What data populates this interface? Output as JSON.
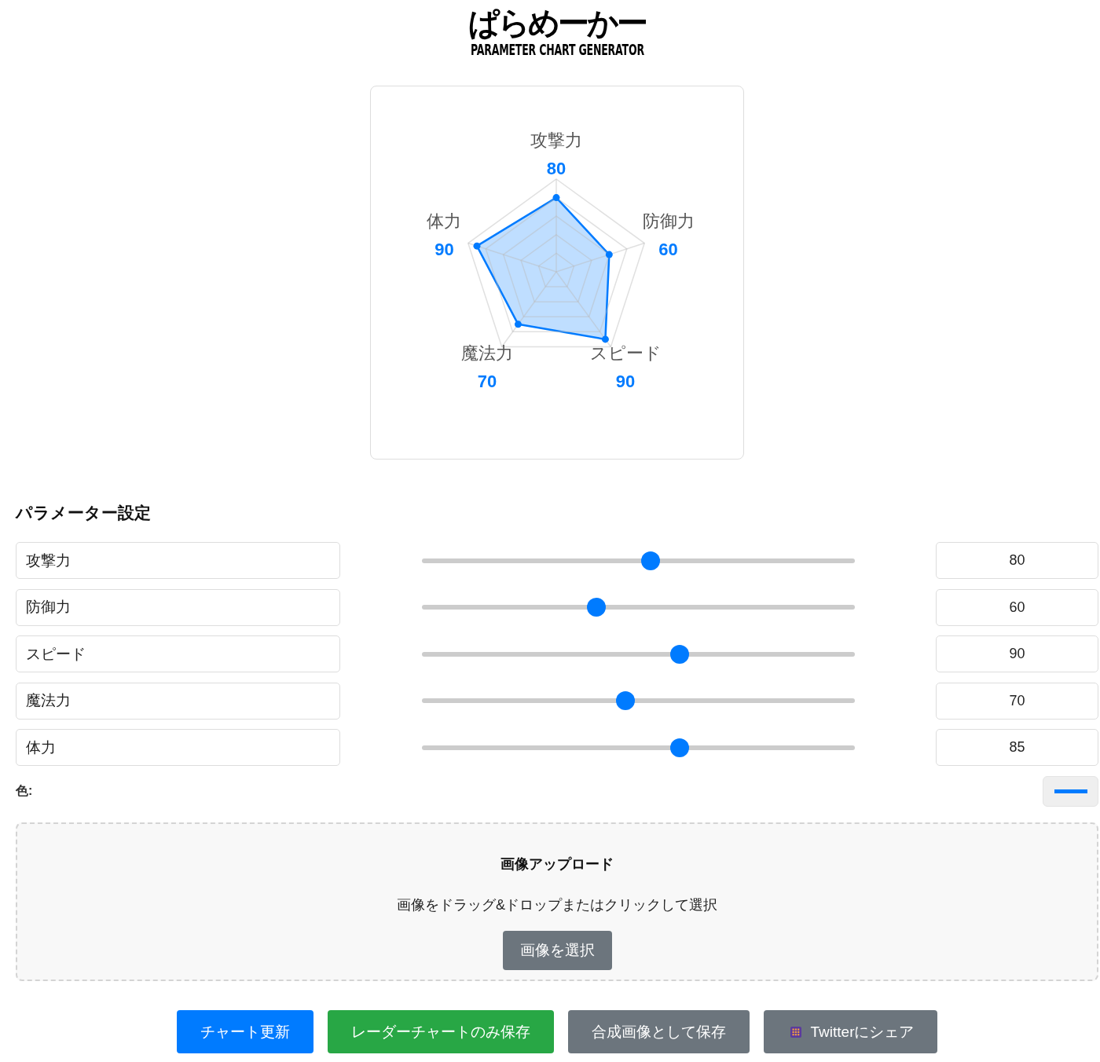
{
  "logo": {
    "title": "ぱらめーかー",
    "subtitle": "PARAMETER CHART GENERATOR"
  },
  "radar_chart": {
    "top": {
      "label": "攻撃力",
      "value": "80"
    },
    "upper": [
      {
        "label": "体力",
        "value": "90"
      },
      {
        "label": "防御力",
        "value": "60"
      }
    ],
    "lower": [
      {
        "label": "魔法力",
        "value": "70"
      },
      {
        "label": "スピード",
        "value": "90"
      }
    ]
  },
  "parameters": {
    "heading": "パラメーター設定",
    "rows": [
      {
        "name": "攻撃力",
        "level": 0.53,
        "value": "80"
      },
      {
        "name": "防御力",
        "level": 0.4,
        "value": "60"
      },
      {
        "name": "スピード",
        "level": 0.6,
        "value": "90"
      },
      {
        "name": "魔法力",
        "level": 0.47,
        "value": "70"
      },
      {
        "name": "体力",
        "level": 0.6,
        "value": "85"
      }
    ]
  },
  "color_picker": {
    "label": "色:",
    "color": "#007bff"
  },
  "upload": {
    "title": "画像アップロード",
    "hint": "画像をドラッグ&ドロップまたはクリックして選択",
    "button": "画像を選択"
  },
  "actions": [
    {
      "label": "チャート更新",
      "kind": "primary",
      "icon": false
    },
    {
      "label": "レーダーチャートのみ保存",
      "kind": "success",
      "icon": false
    },
    {
      "label": "合成画像として保存",
      "kind": "secondary",
      "icon": false
    },
    {
      "label": "Twitterにシェア",
      "kind": "secondary",
      "icon": true
    }
  ]
}
